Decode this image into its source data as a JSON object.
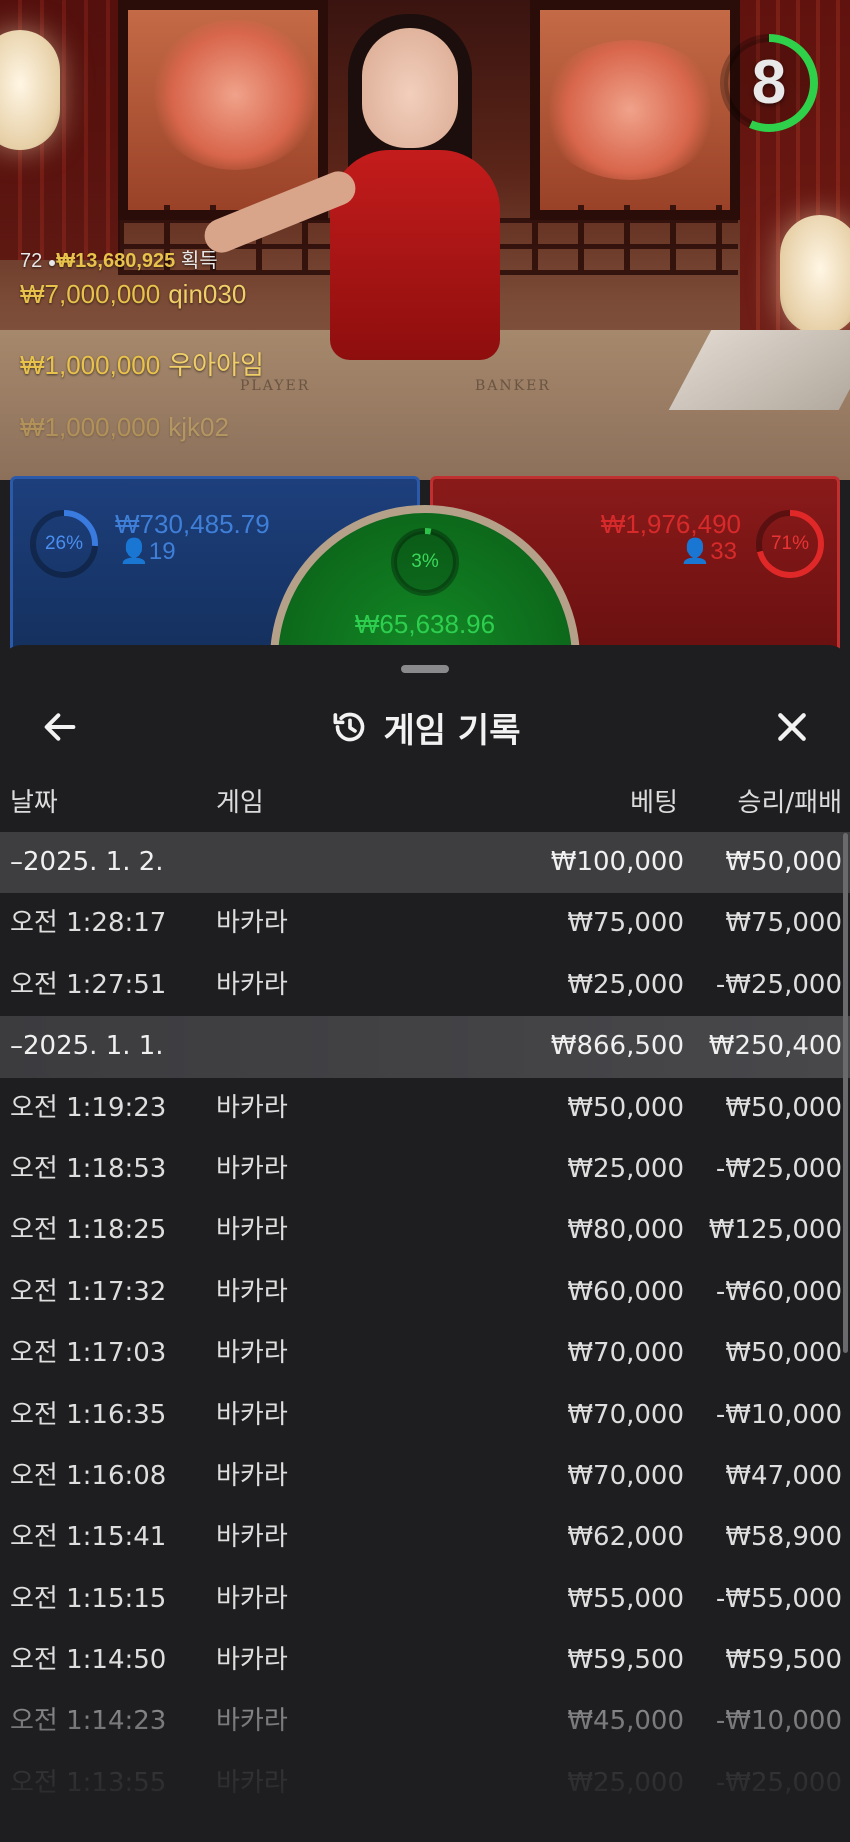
{
  "live": {
    "timer": "8",
    "winners": {
      "count": "72",
      "total": "₩13,680,925",
      "suffix": "획득",
      "rows": [
        {
          "amount": "₩7,000,000",
          "name": "qin030"
        },
        {
          "amount": "₩1,000,000",
          "name": "우아아임"
        },
        {
          "amount": "₩1,000,000",
          "name": "kjk02"
        }
      ]
    },
    "table_labels": {
      "player": "PLAYER",
      "banker": "BANKER"
    }
  },
  "betting": {
    "player": {
      "percent": "26%",
      "amount": "₩730,485.79",
      "players": "19",
      "fill": 0.26
    },
    "tie": {
      "percent": "3%",
      "amount": "₩65,638.96",
      "fill": 0.03
    },
    "banker": {
      "percent": "71%",
      "amount": "₩1,976,490",
      "players": "33",
      "fill": 0.71
    }
  },
  "history": {
    "title": "게임 기록",
    "columns": {
      "date": "날짜",
      "game": "게임",
      "bet": "베팅",
      "result": "승리/패배"
    },
    "rows": [
      {
        "type": "group",
        "date": "–2025. 1. 2.",
        "game": "",
        "bet": "₩100,000",
        "result": "₩50,000"
      },
      {
        "type": "item",
        "date": "오전 1:28:17",
        "game": "바카라",
        "bet": "₩75,000",
        "result": "₩75,000"
      },
      {
        "type": "item",
        "date": "오전 1:27:51",
        "game": "바카라",
        "bet": "₩25,000",
        "result": "-₩25,000"
      },
      {
        "type": "group",
        "date": "–2025. 1. 1.",
        "game": "",
        "bet": "₩866,500",
        "result": "₩250,400"
      },
      {
        "type": "item",
        "date": "오전 1:19:23",
        "game": "바카라",
        "bet": "₩50,000",
        "result": "₩50,000"
      },
      {
        "type": "item",
        "date": "오전 1:18:53",
        "game": "바카라",
        "bet": "₩25,000",
        "result": "-₩25,000"
      },
      {
        "type": "item",
        "date": "오전 1:18:25",
        "game": "바카라",
        "bet": "₩80,000",
        "result": "₩125,000"
      },
      {
        "type": "item",
        "date": "오전 1:17:32",
        "game": "바카라",
        "bet": "₩60,000",
        "result": "-₩60,000"
      },
      {
        "type": "item",
        "date": "오전 1:17:03",
        "game": "바카라",
        "bet": "₩70,000",
        "result": "₩50,000"
      },
      {
        "type": "item",
        "date": "오전 1:16:35",
        "game": "바카라",
        "bet": "₩70,000",
        "result": "-₩10,000"
      },
      {
        "type": "item",
        "date": "오전 1:16:08",
        "game": "바카라",
        "bet": "₩70,000",
        "result": "₩47,000"
      },
      {
        "type": "item",
        "date": "오전 1:15:41",
        "game": "바카라",
        "bet": "₩62,000",
        "result": "₩58,900"
      },
      {
        "type": "item",
        "date": "오전 1:15:15",
        "game": "바카라",
        "bet": "₩55,000",
        "result": "-₩55,000"
      },
      {
        "type": "item",
        "date": "오전 1:14:50",
        "game": "바카라",
        "bet": "₩59,500",
        "result": "₩59,500"
      },
      {
        "type": "item",
        "date": "오전 1:14:23",
        "game": "바카라",
        "bet": "₩45,000",
        "result": "-₩10,000"
      },
      {
        "type": "item",
        "date": "오전 1:13:55",
        "game": "바카라",
        "bet": "₩25,000",
        "result": "-₩25,000"
      }
    ]
  },
  "colors": {
    "player": "#3a7be0",
    "banker": "#e02828",
    "tie": "#2cc34a",
    "timer_ring": "#2fd04a",
    "gold": "#e8c24a",
    "sheet_bg": "#1e1e20",
    "group_row_bg": "#3e3e41"
  },
  "icons": {
    "back": "arrow-left-icon",
    "history": "history-clock-icon",
    "close": "close-icon",
    "person": "person-icon"
  }
}
